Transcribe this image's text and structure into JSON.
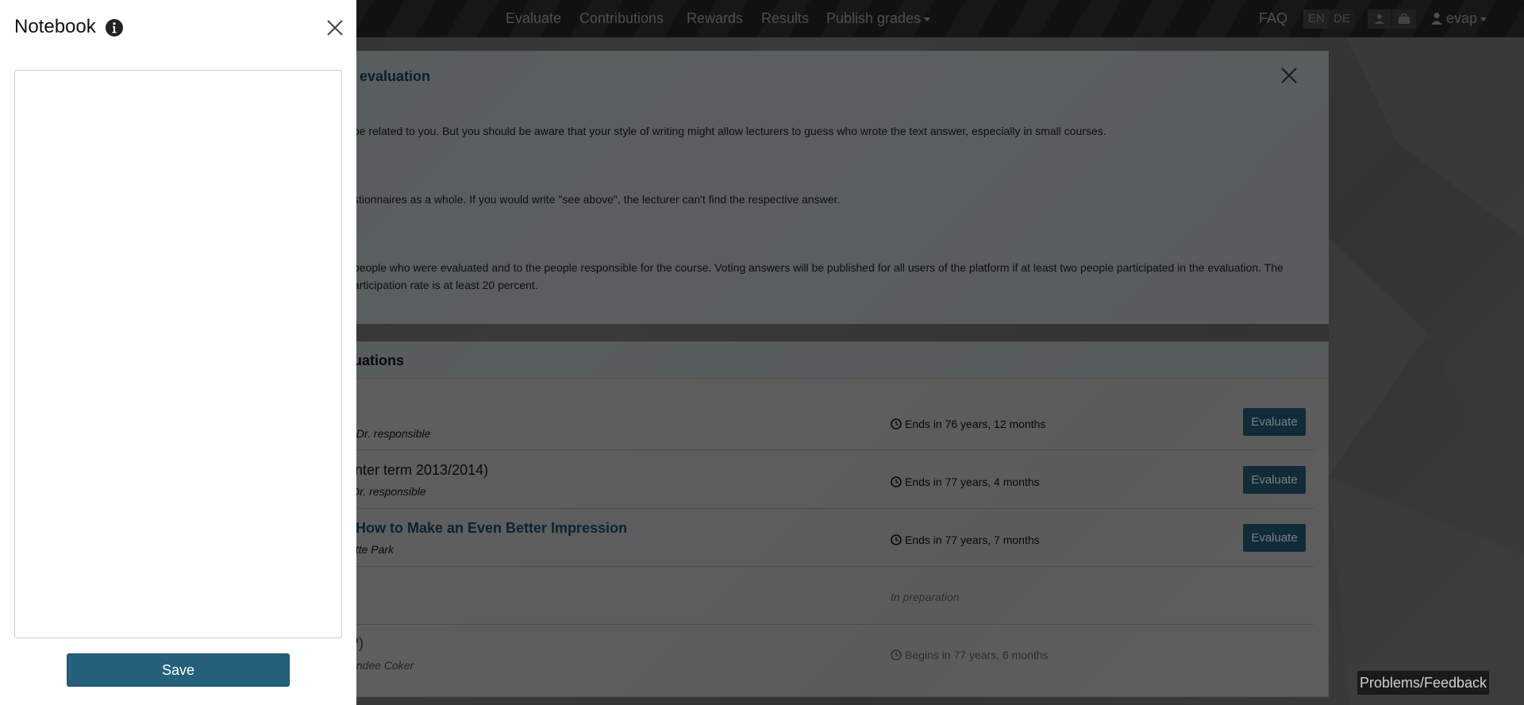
{
  "navbar": {
    "links": [
      {
        "label": "Evaluate"
      },
      {
        "label": "Contributions"
      },
      {
        "label": "Rewards"
      },
      {
        "label": "Results"
      },
      {
        "label": "Publish grades",
        "dropdown": true
      }
    ],
    "faq_label": "FAQ",
    "languages": [
      "EN",
      "DE"
    ],
    "active_language": "EN",
    "user_label": "evap"
  },
  "info_panel": {
    "title_visible": "evaluation",
    "paragraphs": [
      "be related to you. But you should be aware that your style of writing might allow lecturers to guess who wrote the text answer, especially in small courses.",
      "stionnaires as a whole. If you would write \"see above\", the lecturer can't find the respective answer.",
      "people who were evaluated and to the people responsible for the course. Voting answers will be published for all users of the platform if at least two people participated in the evaluation. The",
      "articipation rate is at least 20 percent."
    ]
  },
  "evaluations_card": {
    "title_visible": "uations",
    "rows": [
      {
        "name": "",
        "responsible": ". Dr. responsible",
        "status": "Ends in 76 years, 12 months",
        "action": "Evaluate",
        "muted": false
      },
      {
        "name": "nter term 2013/2014)",
        "responsible": "Dr. responsible",
        "status": "Ends in 77 years, 4 months",
        "action": "Evaluate",
        "muted": false
      },
      {
        "name": "How to Make an Even Better Impression",
        "responsible": "ette Park",
        "status": "Ends in 77 years, 7 months",
        "action": "Evaluate",
        "muted": false,
        "link": true
      },
      {
        "name": "",
        "responsible": "",
        "status": "In preparation",
        "action": "",
        "muted": true
      },
      {
        "name": "P)",
        "responsible": "andee Coker",
        "status": "Begins in 77 years, 6 months",
        "action": "",
        "muted": true
      }
    ]
  },
  "feedback_button": "Problems/Feedback",
  "notebook": {
    "title": "Notebook",
    "textarea_value": "",
    "save_label": "Save"
  },
  "colors": {
    "primary": "#25607a",
    "navbar": "#222222",
    "drawer_bg": "#ffffff"
  },
  "icons": {
    "info": "info-circle-icon",
    "close": "close-icon",
    "clock": "clock-icon",
    "user": "user-icon",
    "briefcase": "briefcase-icon"
  }
}
